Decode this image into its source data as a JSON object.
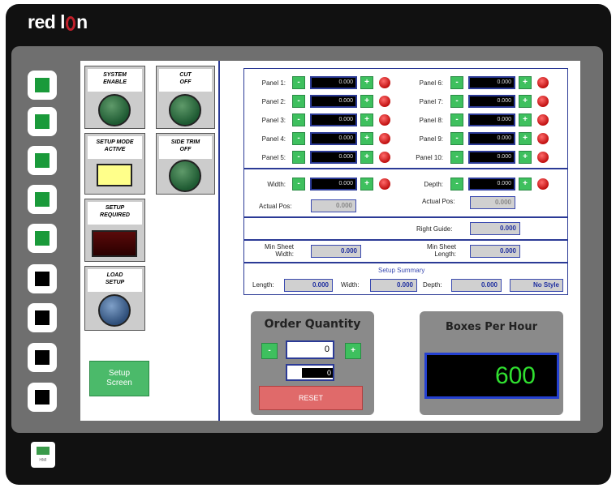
{
  "brand": "red lion",
  "brand_parts": {
    "left": "red l",
    "right": "n"
  },
  "colors": {
    "accent": "#2b3a96",
    "button_green": "#3ec05e",
    "display_green": "#30e030"
  },
  "function_keys": [
    {
      "state": "green"
    },
    {
      "state": "green"
    },
    {
      "state": "green"
    },
    {
      "state": "green"
    },
    {
      "state": "green"
    },
    {
      "state": "black"
    },
    {
      "state": "black"
    },
    {
      "state": "black"
    },
    {
      "state": "black"
    }
  ],
  "indicators": {
    "system_enable": "SYSTEM\nENABLE",
    "cut_off": "CUT\nOFF",
    "setup_mode_active": "SETUP MODE\nACTIVE",
    "side_trim_off": "SIDE TRIM\nOFF",
    "setup_required": "SETUP\nREQUIRED",
    "load_setup": "LOAD\nSETUP"
  },
  "setup_screen_button": "Setup\nScreen",
  "panels_left": [
    {
      "label": "Panel 1:",
      "value": "0.000"
    },
    {
      "label": "Panel 2:",
      "value": "0.000"
    },
    {
      "label": "Panel 3:",
      "value": "0.000"
    },
    {
      "label": "Panel 4:",
      "value": "0.000"
    },
    {
      "label": "Panel 5:",
      "value": "0.000"
    }
  ],
  "panels_right": [
    {
      "label": "Panel 6:",
      "value": "0.000"
    },
    {
      "label": "Panel 7:",
      "value": "0.000"
    },
    {
      "label": "Panel 8:",
      "value": "0.000"
    },
    {
      "label": "Panel 9:",
      "value": "0.000"
    },
    {
      "label": "Panel 10:",
      "value": "0.000"
    }
  ],
  "controls": {
    "minus": "-",
    "plus": "+"
  },
  "width": {
    "label": "Width:",
    "value": "0.000",
    "actual_label": "Actual Pos:",
    "actual_value": "0.000"
  },
  "depth": {
    "label": "Depth:",
    "value": "0.000",
    "actual_label": "Actual Pos:",
    "actual_value": "0.000"
  },
  "right_guide": {
    "label": "Right Guide:",
    "value": "0.000"
  },
  "min_sheet_width": {
    "label": "Min Sheet\nWidth:",
    "value": "0.000"
  },
  "min_sheet_length": {
    "label": "Min Sheet\nLength:",
    "value": "0.000"
  },
  "setup_summary": {
    "title": "Setup Summary",
    "length_label": "Length:",
    "length_value": "0.000",
    "width_label": "Width:",
    "width_value": "0.000",
    "depth_label": "Depth:",
    "depth_value": "0.000",
    "style_value": "No Style"
  },
  "order_quantity": {
    "title": "Order Quantity",
    "value": "0",
    "keypad_value": "0",
    "reset_label": "RESET"
  },
  "boxes_per_hour": {
    "title": "Boxes Per Hour",
    "value": "600"
  },
  "bottom_icon_label": "HMI"
}
